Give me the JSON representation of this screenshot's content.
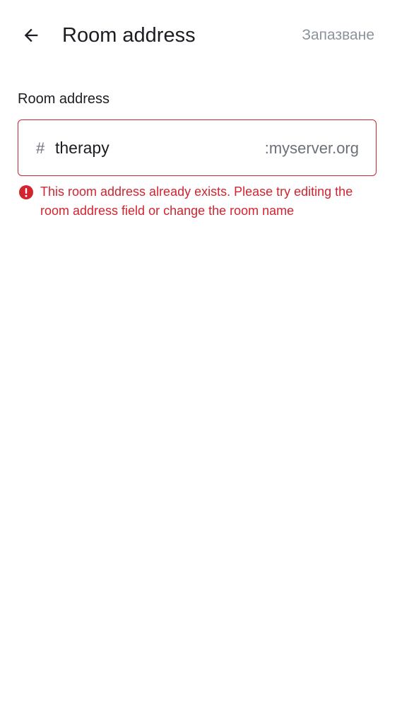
{
  "header": {
    "title": "Room address",
    "save_label": "Запазване",
    "back_icon": "arrow-left-icon"
  },
  "field": {
    "label": "Room address",
    "prefix": "#",
    "value": "therapy",
    "suffix": ":myserver.org"
  },
  "error": {
    "icon": "error-icon",
    "message": "This room address already exists. Please try editing the room address field or change the room name"
  },
  "colors": {
    "error": "#d1242f",
    "text_primary": "#1b1d22",
    "text_secondary": "#6b7079",
    "disabled": "#8d939c"
  }
}
